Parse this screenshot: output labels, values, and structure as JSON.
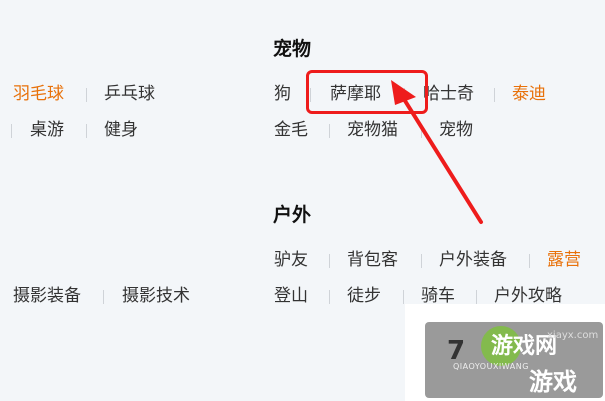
{
  "sections": {
    "pets": {
      "title": "宠物",
      "items": [
        "狗",
        "萨摩耶",
        "哈士奇",
        "泰迪",
        "金毛",
        "宠物猫",
        "宠物"
      ]
    },
    "outdoor": {
      "title": "户外",
      "items": [
        "驴友",
        "背包客",
        "户外装备",
        "露营",
        "登山",
        "徒步",
        "骑车",
        "户外攻略"
      ]
    },
    "left_col": {
      "row1": [
        "羽毛球",
        "乒乓球"
      ],
      "row2": [
        "桌游",
        "健身"
      ],
      "row3": [
        "摄影装备",
        "摄影技术"
      ]
    }
  },
  "watermark": {
    "digit": "7",
    "text1": "游戏网",
    "url": "xiayx.com",
    "pinyin": "QIAOYOUXIWANG",
    "text2": "游戏"
  },
  "colors": {
    "accent": "#e8710a",
    "highlight": "#ee1c1c"
  }
}
